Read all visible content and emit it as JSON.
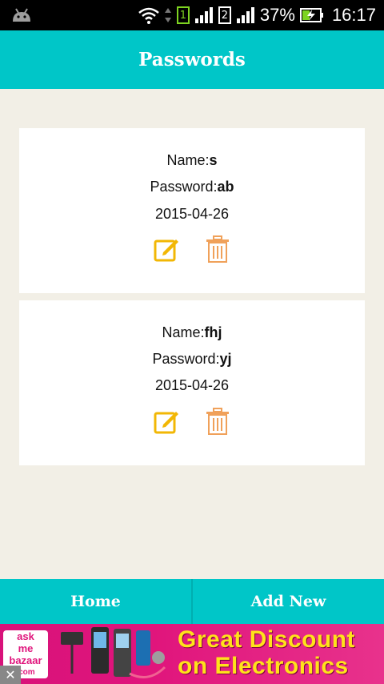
{
  "status_bar": {
    "battery_percent": "37%",
    "time": "16:17",
    "sim1": "1",
    "sim2": "2"
  },
  "header": {
    "title": "Passwords"
  },
  "entries": [
    {
      "name_label": "Name:",
      "name_value": "s",
      "password_label": "Password:",
      "password_value": "ab",
      "date": "2015-04-26"
    },
    {
      "name_label": "Name:",
      "name_value": "fhj",
      "password_label": "Password:",
      "password_value": "yj",
      "date": "2015-04-26"
    }
  ],
  "bottom_nav": {
    "home_label": "Home",
    "add_new_label": "Add New"
  },
  "ad": {
    "logo_line1": "ask",
    "logo_line2": "me",
    "logo_line3": "bazaar",
    "logo_line4": ".com",
    "headline1": "Great Discount",
    "headline2": "on Electronics",
    "close_glyph": "✕"
  },
  "colors": {
    "accent": "#00c6c8",
    "background": "#f2efe6",
    "edit_icon": "#f2b705",
    "delete_icon": "#f0a15a",
    "ad_background": "#e0157c",
    "ad_text": "#ffe21a"
  },
  "icons": {
    "edit": "edit-icon",
    "delete": "trash-icon"
  }
}
